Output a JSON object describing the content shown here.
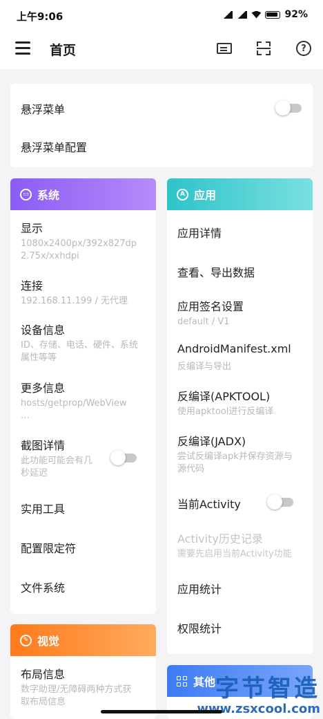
{
  "status_bar": {
    "time": "上午9:06",
    "battery": "92%"
  },
  "app_bar": {
    "title": "首页"
  },
  "top_card": {
    "floating_menu": "悬浮菜单",
    "floating_menu_config": "悬浮菜单配置",
    "floating_menu_enabled": false
  },
  "system": {
    "title": "系统",
    "display": {
      "label": "显示",
      "sub_line1": "1080x2400px/392x827dp",
      "sub_line2": "2.75x/xxhdpi"
    },
    "connection": {
      "label": "连接",
      "sub": "192.168.11.199 / 无代理"
    },
    "device_info": {
      "label": "设备信息",
      "sub_line1": "ID、存储、电话、硬件、系统",
      "sub_line2": "属性等等"
    },
    "more_info": {
      "label": "更多信息",
      "sub_line1": "hosts/getprop/WebView",
      "sub_line2": "…"
    },
    "screenshot": {
      "label": "截图详情",
      "sub_line1": "此功能可能会有几",
      "sub_line2": "秒延迟",
      "enabled": false
    },
    "tools": "实用工具",
    "qualifiers": "配置限定符",
    "filesystem": "文件系统"
  },
  "app": {
    "title": "应用",
    "details": "应用详情",
    "export": "查看、导出数据",
    "signature": {
      "label": "应用签名设置",
      "sub": "default / V1"
    },
    "manifest": {
      "label": "AndroidManifest.xml",
      "sub": "反编译与导出"
    },
    "apktool": {
      "label": "反编译(APKTOOL)",
      "sub": "使用apktool进行反编译"
    },
    "jadx": {
      "label": "反编译(JADX)",
      "sub_line1": "尝试反编译apk并保存资源与",
      "sub_line2": "源代码"
    },
    "current_activity": {
      "label": "当前Activity",
      "enabled": false
    },
    "activity_history": {
      "label": "Activity历史记录",
      "sub": "需要先启用当前Activity功能"
    },
    "usage_stats": "应用统计",
    "permission_stats": "权限统计"
  },
  "visual": {
    "title": "视觉",
    "layout": {
      "label": "布局信息",
      "sub_line1": "数字助理/无障碍两种方式获",
      "sub_line2": "取布局信息"
    }
  },
  "other": {
    "title": "其他"
  },
  "watermark": {
    "brand": "字节智造",
    "url": "www.zsxcool.com"
  }
}
